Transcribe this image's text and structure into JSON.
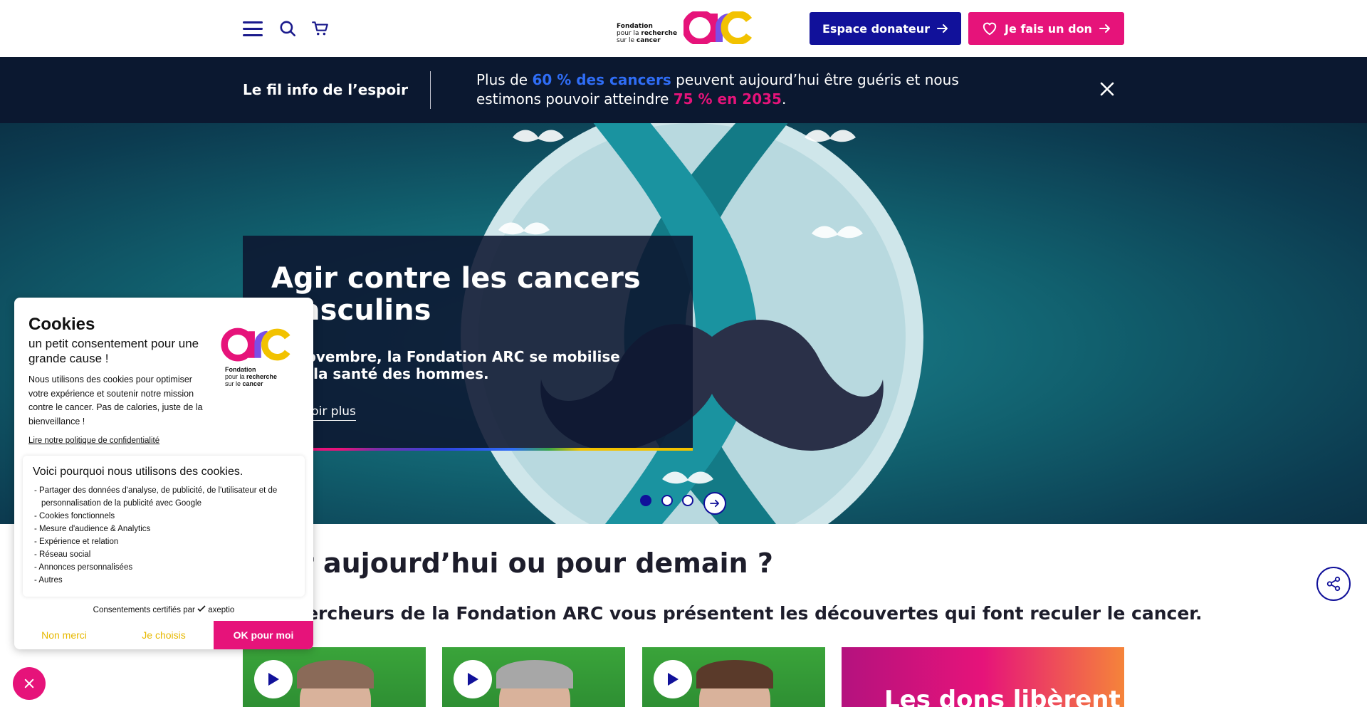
{
  "header": {
    "logo_line1": "Fondation",
    "logo_line2_prefix": "pour la ",
    "logo_line2_bold": "recherche",
    "logo_line3_prefix": "sur le ",
    "logo_line3_bold": "cancer",
    "menu_icon": "hamburger-icon",
    "search_icon": "search-icon",
    "cart_icon": "cart-icon",
    "donor_button": "Espace donateur",
    "donate_button": "Je fais un don"
  },
  "info": {
    "title": "Le fil info de l’espoir",
    "msg_part1": "Plus de ",
    "msg_highlight1": "60 % des cancers",
    "msg_part2": " peuvent aujourd’hui être guéris et nous estimons pouvoir atteindre ",
    "msg_highlight2": "75 % en 2035",
    "msg_part3": "."
  },
  "hero": {
    "title": "Agir contre les cancers masculins",
    "subtitle": "En novembre, la Fondation ARC se mobilise pour la santé des hommes.",
    "link": "En savoir plus",
    "slides_total": 3,
    "active_slide": 1
  },
  "section": {
    "title": "Pour aujourd’hui ou pour demain ?",
    "subtitle": "Les chercheurs de la Fondation ARC vous présentent les découvertes qui font reculer le cancer.",
    "promo_text": "Les dons libèrent"
  },
  "cookie": {
    "title": "Cookies",
    "subtitle": "un petit consentement pour une grande cause !",
    "text": "Nous utilisons des cookies pour optimiser votre expérience et soutenir notre mission contre le cancer. Pas de calories, juste de la bienveillance !",
    "policy_link": "Lire notre politique de confidentialité",
    "box_title": "Voici pourquoi nous utilisons des cookies.",
    "purposes": [
      "- Partager des données d'analyse, de publicité, de l'utilisateur et de personnalisation de la publicité avec Google",
      "- Cookies fonctionnels",
      "- Mesure d'audience & Analytics",
      "- Expérience et relation",
      "- Réseau social",
      "- Annonces personnalisées",
      "- Autres"
    ],
    "certified": "Consentements certifiés par ",
    "certified_brand": "axeptio",
    "btn_no": "Non merci",
    "btn_choose": "Je choisis",
    "btn_ok": "OK pour moi"
  },
  "colors": {
    "navy": "#11119a",
    "pink": "#e6137a",
    "banner": "#0b1830",
    "yellow": "#f2c200",
    "highlight_blue": "#2f6df6"
  }
}
